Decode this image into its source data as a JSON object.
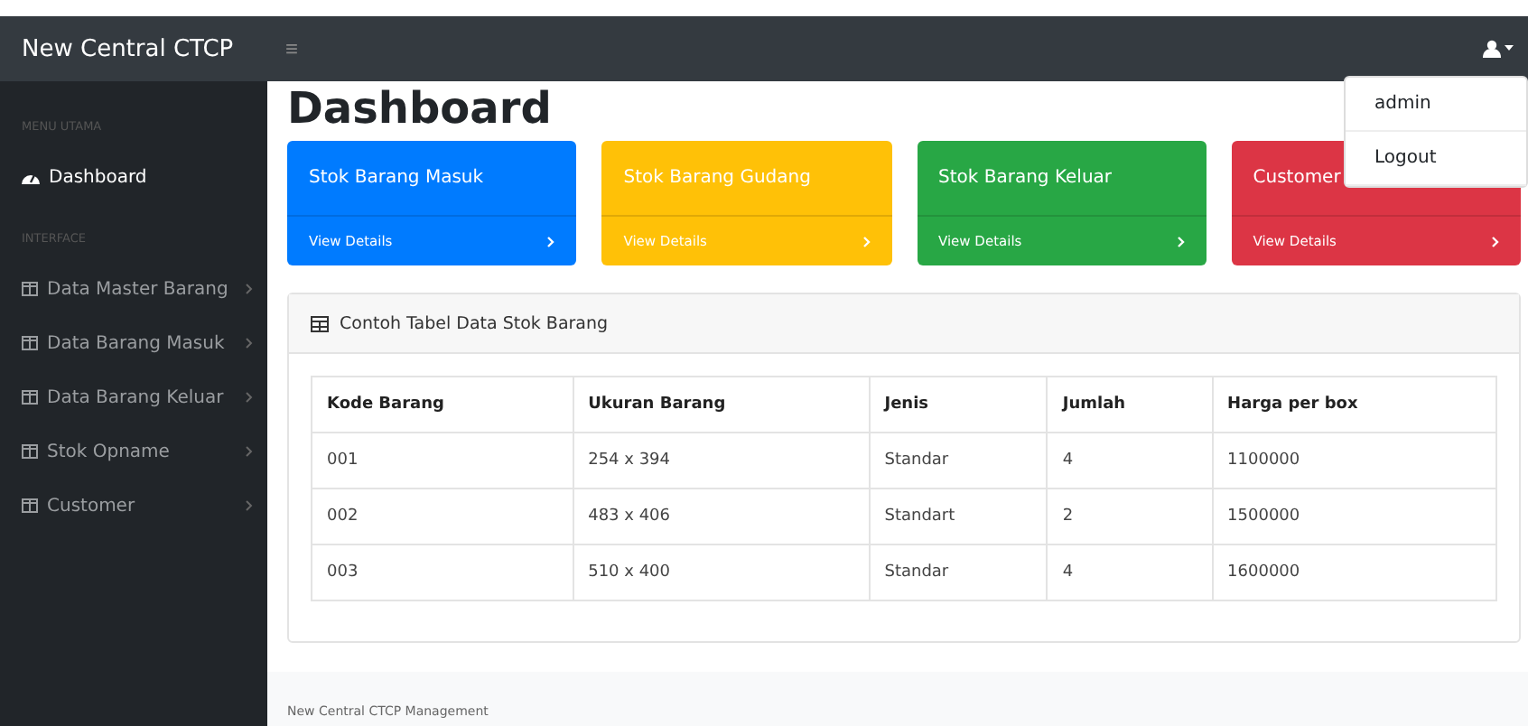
{
  "navbar": {
    "brand": "New Central CTCP",
    "toggle": "≡"
  },
  "user_menu": {
    "expanded": true,
    "items": [
      "admin",
      "Logout"
    ]
  },
  "sidebar": {
    "sections": [
      {
        "heading": "MENU UTAMA",
        "items": [
          {
            "label": "Dashboard",
            "kind": "link",
            "selected": true
          }
        ]
      },
      {
        "heading": "INTERFACE",
        "items": [
          {
            "label": "Data Master Barang",
            "kind": "collapse",
            "selected": false
          },
          {
            "label": "Data Barang Masuk",
            "kind": "collapse",
            "selected": false
          },
          {
            "label": "Data Barang Keluar",
            "kind": "collapse",
            "selected": false
          },
          {
            "label": "Stok Opname",
            "kind": "collapse",
            "selected": false
          },
          {
            "label": "Customer",
            "kind": "collapse",
            "selected": false
          }
        ]
      }
    ]
  },
  "page_title": "Dashboard",
  "cards": [
    {
      "title": "Stok Barang Masuk",
      "link": "View Details",
      "color": "#007bff"
    },
    {
      "title": "Stok Barang Gudang",
      "link": "View Details",
      "color": "#ffc107"
    },
    {
      "title": "Stok Barang Keluar",
      "link": "View Details",
      "color": "#28a745"
    },
    {
      "title": "Customer",
      "link": "View Details",
      "color": "#dc3545"
    }
  ],
  "table_card": {
    "title": "Contoh Tabel Data Stok Barang",
    "columns": [
      "Kode Barang",
      "Ukuran Barang",
      "Jenis",
      "Jumlah",
      "Harga per box"
    ],
    "rows": [
      [
        "001",
        "254 x 394",
        "Standar",
        "4",
        "1100000"
      ],
      [
        "002",
        "483 x 406",
        "Standart",
        "2",
        "1500000"
      ],
      [
        "003",
        "510 x 400",
        "Standar",
        "4",
        "1600000"
      ]
    ]
  },
  "footer": "New Central CTCP Management"
}
